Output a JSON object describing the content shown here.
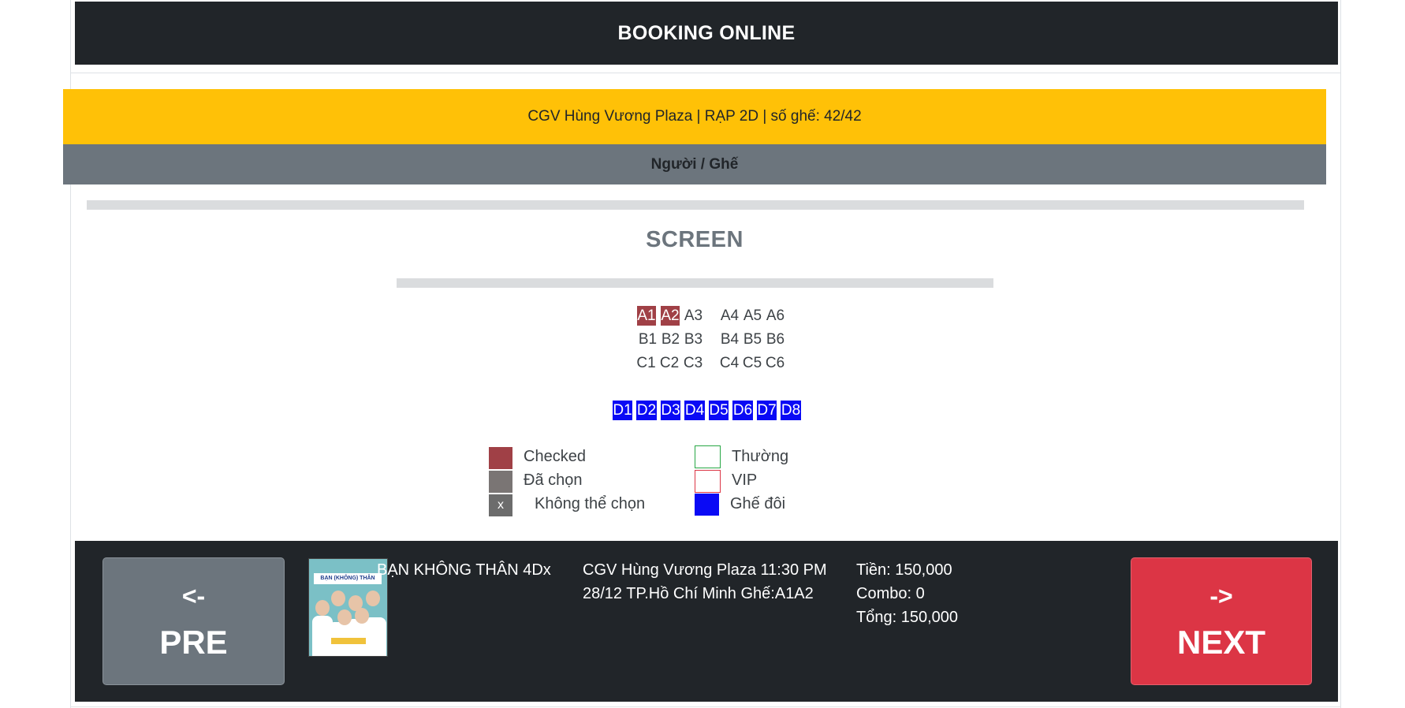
{
  "header": {
    "title": "BOOKING ONLINE"
  },
  "cinema_info": {
    "text": "CGV Hùng Vương Plaza | RẠP 2D | số ghế: 42/42"
  },
  "seat_type_header": {
    "text": "Người / Ghế"
  },
  "screen": {
    "label": "SCREEN"
  },
  "seats": {
    "row_a": [
      {
        "id": "A1",
        "status": "checked"
      },
      {
        "id": "A2",
        "status": "checked"
      },
      {
        "id": "A3",
        "status": "normal"
      },
      {
        "id": "A4",
        "status": "normal"
      },
      {
        "id": "A5",
        "status": "normal"
      },
      {
        "id": "A6",
        "status": "normal"
      }
    ],
    "row_b": [
      {
        "id": "B1",
        "status": "normal"
      },
      {
        "id": "B2",
        "status": "normal"
      },
      {
        "id": "B3",
        "status": "normal"
      },
      {
        "id": "B4",
        "status": "normal"
      },
      {
        "id": "B5",
        "status": "normal"
      },
      {
        "id": "B6",
        "status": "normal"
      }
    ],
    "row_c": [
      {
        "id": "C1",
        "status": "normal"
      },
      {
        "id": "C2",
        "status": "normal"
      },
      {
        "id": "C3",
        "status": "normal"
      },
      {
        "id": "C4",
        "status": "normal"
      },
      {
        "id": "C5",
        "status": "normal"
      },
      {
        "id": "C6",
        "status": "normal"
      }
    ],
    "row_d": [
      {
        "id": "D1",
        "status": "double"
      },
      {
        "id": "D2",
        "status": "double"
      },
      {
        "id": "D3",
        "status": "double"
      },
      {
        "id": "D4",
        "status": "double"
      },
      {
        "id": "D5",
        "status": "double"
      },
      {
        "id": "D6",
        "status": "double"
      },
      {
        "id": "D7",
        "status": "double"
      },
      {
        "id": "D8",
        "status": "double"
      }
    ]
  },
  "legend": {
    "checked": "Checked",
    "selected": "Đã chọn",
    "unavailable": "Không thể chọn",
    "unavailable_mark": "x",
    "normal": "Thường",
    "vip": "VIP",
    "double": "Ghế đôi"
  },
  "colors": {
    "checked": "#a04046",
    "selected": "#7a7574",
    "unavailable": "#6c6c6c",
    "normal_border": "#28a745",
    "vip_border": "#dc3545",
    "double": "#0a0af5",
    "info_bar": "#ffc107",
    "type_bar": "#6c757d",
    "dark": "#212529",
    "next_button": "#dc3545",
    "pre_button": "#6c757d"
  },
  "footer": {
    "pre_arrow": "<-",
    "pre_label": "PRE",
    "next_arrow": "->",
    "next_label": "NEXT",
    "movie_title": "BẠN KHÔNG THÂN 4Dx",
    "poster_title": "BẠN (KHÔNG) THÂN",
    "showtime_line1": "CGV Hùng Vương Plaza 11:30 PM",
    "showtime_line2": "28/12 TP.Hồ Chí Minh Ghế:A1A2",
    "price": "Tiền: 150,000",
    "combo": "Combo: 0",
    "total": "Tổng: 150,000"
  }
}
